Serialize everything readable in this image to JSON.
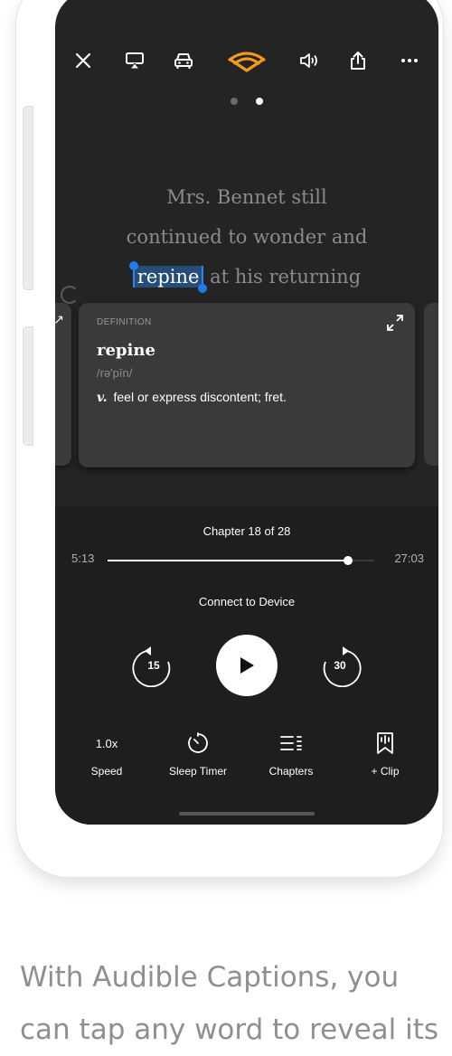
{
  "topbar": {
    "icons": [
      "close-icon",
      "airplay-icon",
      "car-mode-icon",
      "audible-logo-icon",
      "volume-icon",
      "share-icon",
      "more-icon"
    ],
    "accent_color": "#F7991C"
  },
  "carousel": {
    "pages": 2,
    "active_index": 1
  },
  "caption": {
    "line1": "Mrs. Bennet still",
    "line2": "continued to wonder and",
    "selected_word": "repine",
    "line3_rest": "at his returning",
    "highlight_color": "#244E79",
    "handle_color": "#1E7CF0"
  },
  "definition": {
    "label": "DEFINITION",
    "word": "repine",
    "pronunciation": "/rə'pīn/",
    "part_of_speech": "v.",
    "meaning": "feel or express discontent; fret."
  },
  "player": {
    "chapter": "Chapter 18 of 28",
    "elapsed": "5:13",
    "remaining": "27:03",
    "progress": 0.9,
    "connect_label": "Connect to Device",
    "skip_back": "15",
    "skip_forward": "30"
  },
  "controls": {
    "speed_value": "1.0x",
    "speed_label": "Speed",
    "sleep_label": "Sleep Timer",
    "chapters_label": "Chapters",
    "clip_label": "+ Clip"
  },
  "promo": {
    "line1": "With Audible Captions, you",
    "line2": "can tap any word to reveal its"
  }
}
